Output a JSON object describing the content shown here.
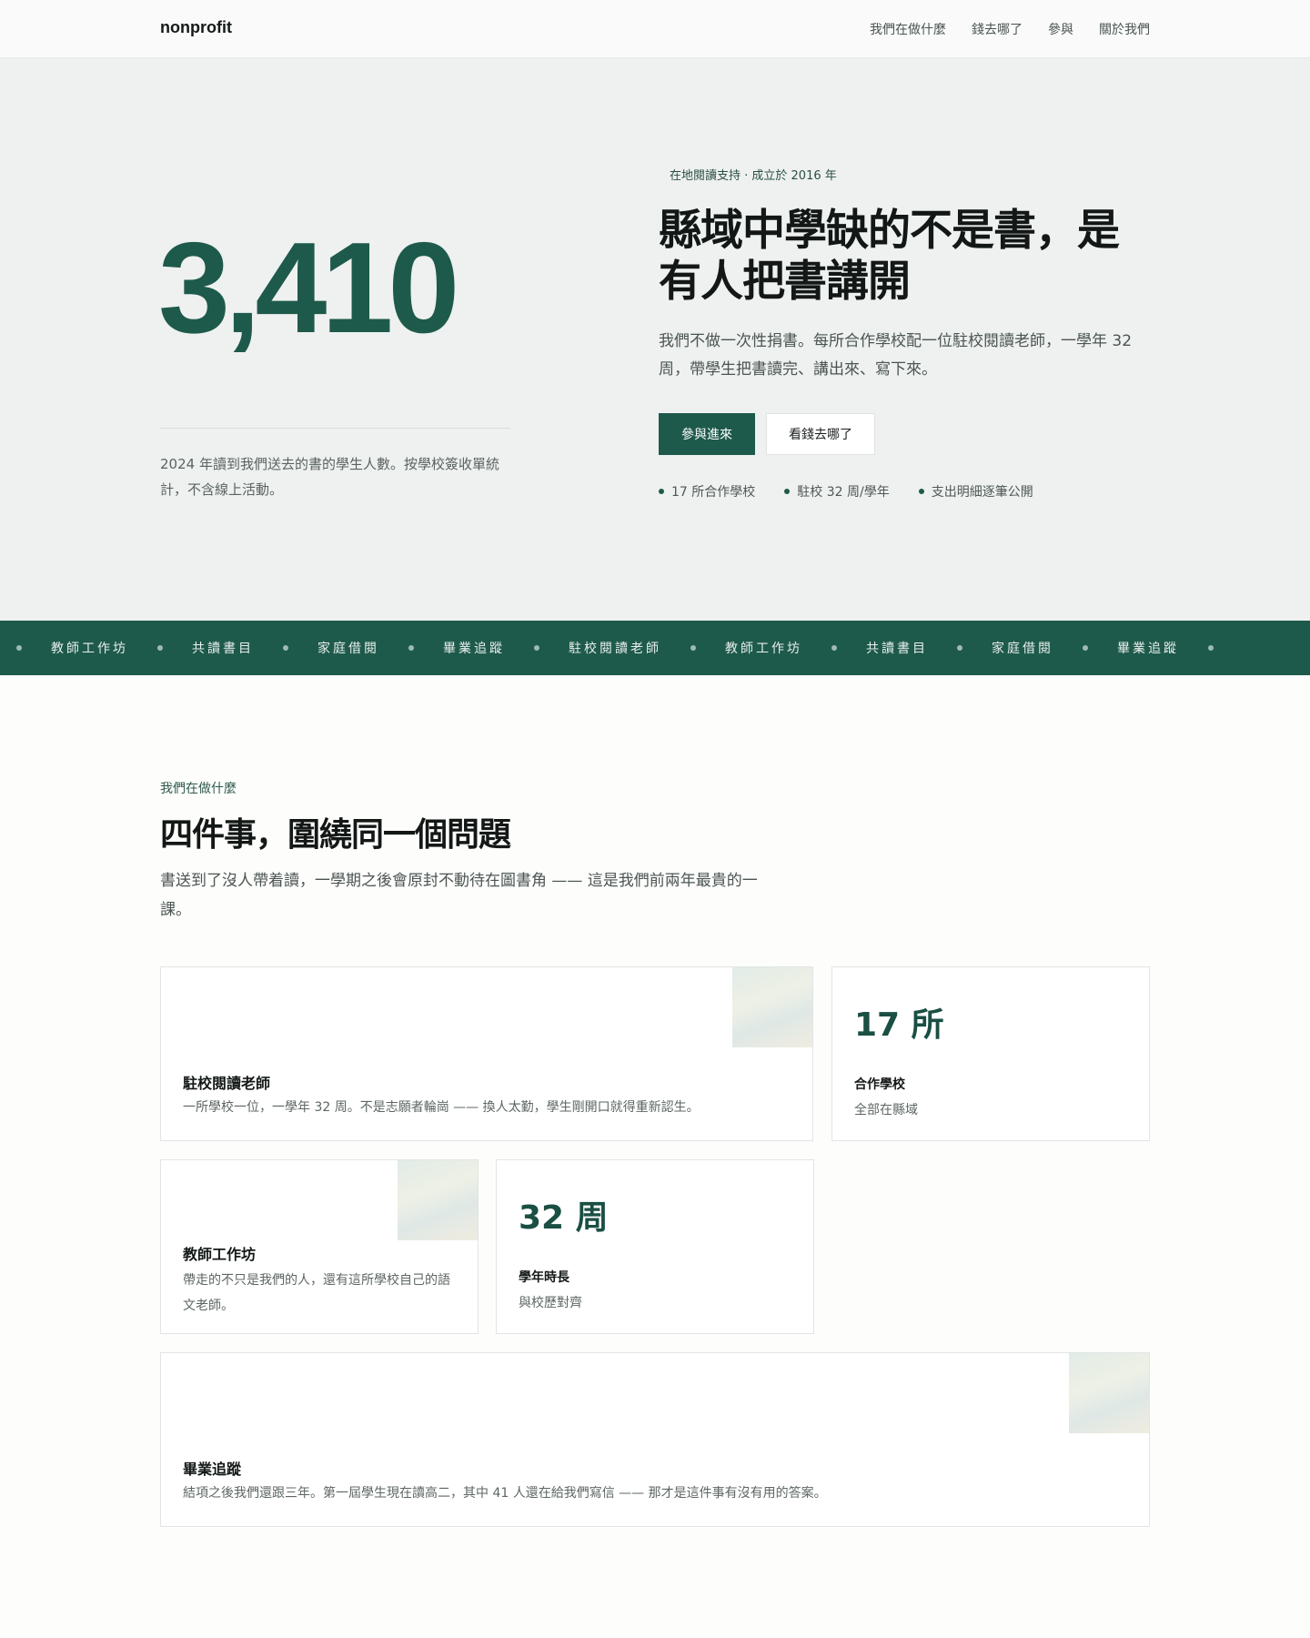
{
  "header": {
    "brand": "nonprofit",
    "nav": [
      "我們在做什麼",
      "錢去哪了",
      "參與",
      "關於我們"
    ]
  },
  "hero": {
    "big_number": "3,410",
    "caption": "2024 年讀到我們送去的書的學生人數。按學校簽收單統計，不含線上活動。",
    "eyebrow": "在地閱讀支持 · 成立於 2016 年",
    "title_line1": "縣域中學缺的不是書，是",
    "title_line2": "有人把書講開",
    "lead": "我們不做一次性捐書。每所合作學校配一位駐校閱讀老師，一學年 32 周，帶學生把書讀完、講出來、寫下來。",
    "primary_button": "參與進來",
    "secondary_button": "看錢去哪了",
    "bullets": [
      "17 所合作學校",
      "駐校 32 周/學年",
      "支出明細逐筆公開"
    ]
  },
  "band": {
    "items": [
      "教師工作坊",
      "共讀書目",
      "家庭借閱",
      "畢業追蹤",
      "駐校閱讀老師",
      "教師工作坊",
      "共讀書目",
      "家庭借閱",
      "畢業追蹤"
    ]
  },
  "section": {
    "eyebrow": "我們在做什麼",
    "title": "四件事，圍繞同一個問題",
    "lead": "書送到了沒人帶着讀，一學期之後會原封不動待在圖書角 —— 這是我們前兩年最貴的一課。"
  },
  "cards": {
    "resident": {
      "title": "駐校閱讀老師",
      "text": "一所學校一位，一學年 32 周。不是志願者輪崗 —— 換人太勤，學生剛開口就得重新認生。"
    },
    "schools": {
      "value": "17 所",
      "label": "合作學校",
      "sub": "全部在縣域"
    },
    "workshop": {
      "title": "教師工作坊",
      "text": "帶走的不只是我們的人，還有這所學校自己的語文老師。"
    },
    "weeks": {
      "value": "32 周",
      "label": "學年時長",
      "sub": "與校歷對齊"
    },
    "tracking": {
      "title": "畢業追蹤",
      "text": "結項之後我們還跟三年。第一屆學生現在讀高二，其中 41 人還在給我們寫信 —— 那才是這件事有沒有用的答案。"
    }
  }
}
